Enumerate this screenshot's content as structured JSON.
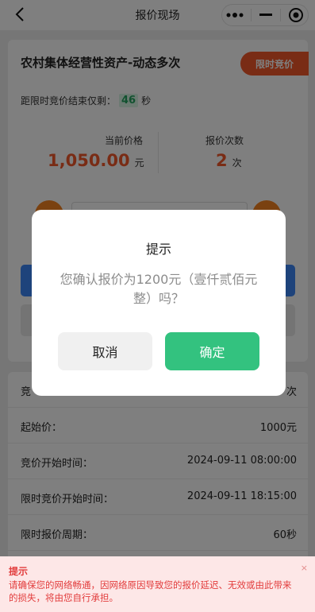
{
  "header": {
    "title": "报价现场",
    "back_icon": "chevron-left-icon",
    "capsule_icons": [
      "more-dots-icon",
      "minimize-icon",
      "close-target-icon"
    ]
  },
  "auction": {
    "title": "农村集体经营性资产-动态多次",
    "badge": "限时竞价",
    "countdown_prefix": "距限时竞价结束仅剩：",
    "countdown_value": "46",
    "countdown_unit": "秒",
    "current_price_label": "当前价格",
    "current_price_value": "1,050.00",
    "current_price_unit": "元",
    "bid_count_label": "报价次数",
    "bid_count_value": "2",
    "bid_count_unit": "次"
  },
  "info": {
    "rows": [
      {
        "label": "竞",
        "value": "次"
      },
      {
        "label": "起始价：",
        "value": "1000元"
      },
      {
        "label": "竞价开始时间：",
        "value": "2024-09-11 08:00:00"
      },
      {
        "label": "限时竞价开始时间：",
        "value": "2024-09-11 18:15:00"
      },
      {
        "label": "限时报价周期：",
        "value": "60秒"
      }
    ]
  },
  "dialog": {
    "title": "提示",
    "message": "您确认报价为1200元（壹仟贰佰元整）吗？",
    "cancel_label": "取消",
    "confirm_label": "确定"
  },
  "notice": {
    "title": "提示",
    "text": "请确保您的网络畅通，因网络原因导致您的报价延迟、无效或由此带来的损失，将由您自行承担。",
    "close": "×"
  },
  "colors": {
    "accent_orange": "#f2582b",
    "confirm_green": "#33c27f",
    "primary_blue": "#3d86f6",
    "notice_red": "#e23c3c"
  }
}
